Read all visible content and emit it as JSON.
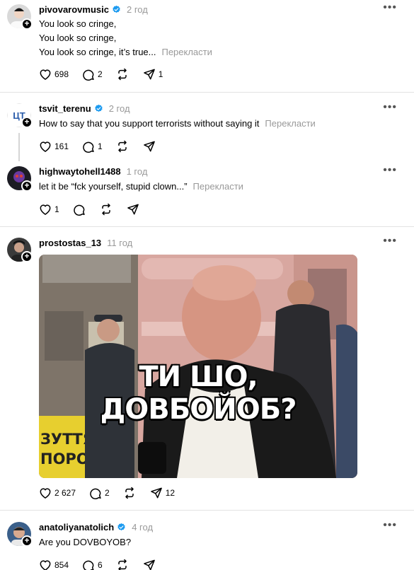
{
  "posts": [
    {
      "username": "pivovarovmusic",
      "verified": true,
      "time": "2 год",
      "lines": [
        "You look so cringe,",
        "You look so cringe,",
        "You look so cringe, it’s true..."
      ],
      "translate": "Перекласти",
      "likes": "698",
      "replies": "2",
      "reposts": "",
      "shares": "1"
    },
    {
      "username": "tsvit_terenu",
      "verified": true,
      "time": "2 год",
      "lines": [
        "How to say that you support terrorists without saying it"
      ],
      "translate": "Перекласти",
      "likes": "161",
      "replies": "1",
      "reposts": "",
      "shares": ""
    },
    {
      "username": "highwaytohell1488",
      "verified": false,
      "time": "1 год",
      "lines": [
        "let it be “fck yourself, stupid clown...”"
      ],
      "translate": "Перекласти",
      "likes": "1",
      "replies": "",
      "reposts": "",
      "shares": ""
    },
    {
      "username": "prostostas_13",
      "verified": false,
      "time": "11 год",
      "image_caption": "ТИ ШО, ДОВБОЙОБ?",
      "image_sign": "ЗУТТЯ ПОРО",
      "likes": "2 627",
      "replies": "2",
      "reposts": "",
      "shares": "12"
    },
    {
      "username": "anatoliyanatolich",
      "verified": true,
      "time": "4 год",
      "lines": [
        "Are you DOVBOYOB?"
      ],
      "likes": "854",
      "replies": "6",
      "reposts": "",
      "shares": ""
    }
  ],
  "colors": {
    "verified": "#1d9bf0",
    "muted": "#999999",
    "separator": "#e3e3e3"
  },
  "icons": [
    "heart-icon",
    "comment-icon",
    "repost-icon",
    "share-icon",
    "more-icon",
    "follow-plus-icon",
    "verified-badge-icon"
  ]
}
